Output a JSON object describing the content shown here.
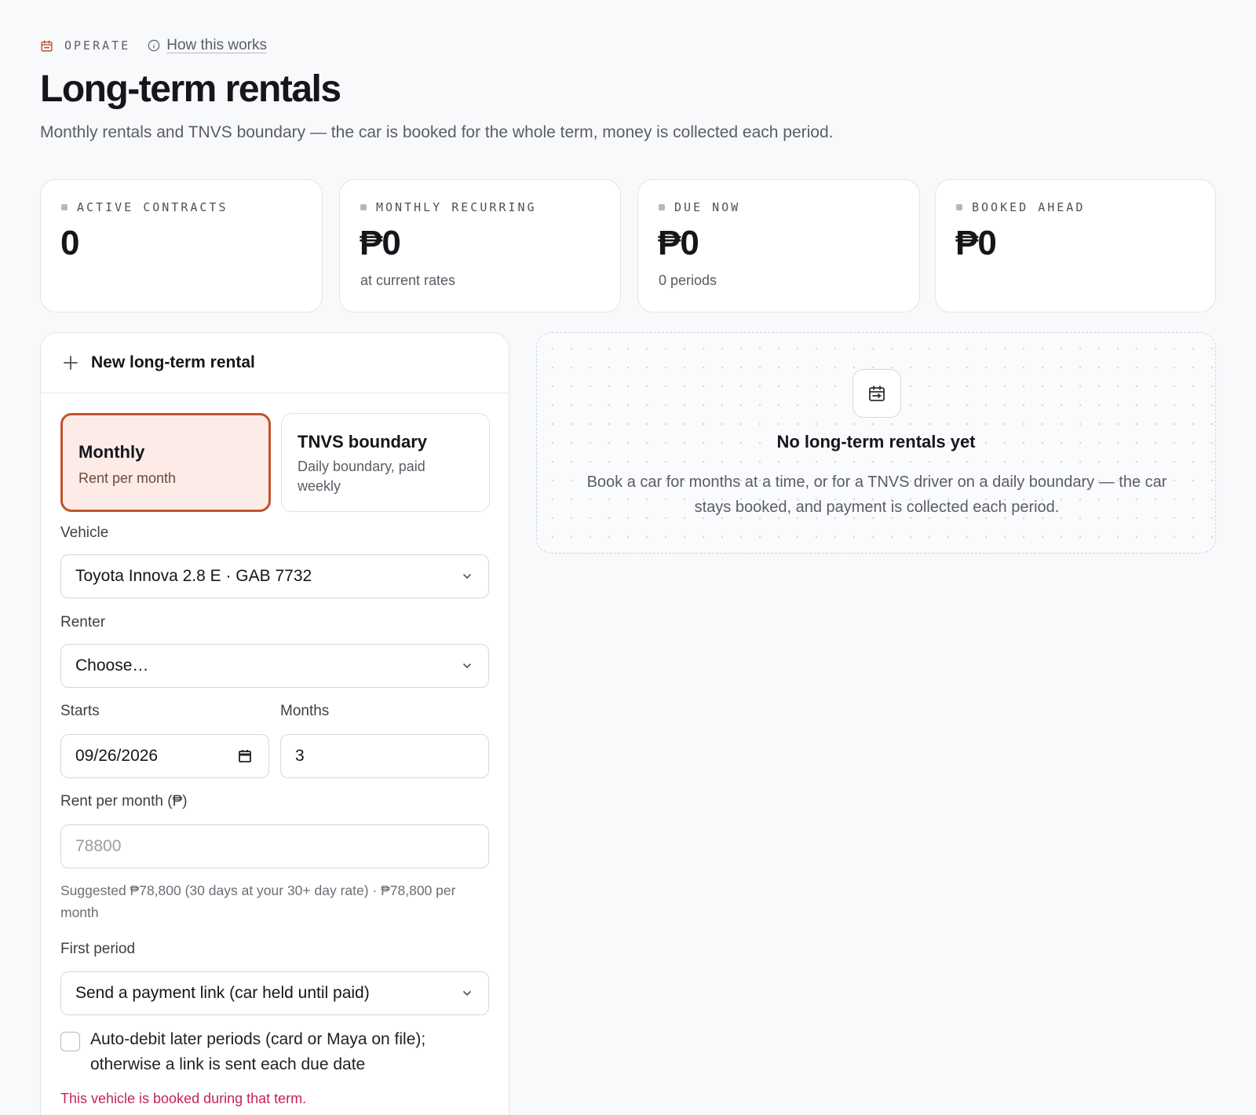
{
  "header": {
    "eyebrow": "OPERATE",
    "help_link": "How this works",
    "title": "Long-term rentals",
    "subtitle": "Monthly rentals and TNVS boundary — the car is booked for the whole term, money is collected each period."
  },
  "stats": [
    {
      "label": "ACTIVE CONTRACTS",
      "value": "0",
      "sub": ""
    },
    {
      "label": "MONTHLY RECURRING",
      "value": "₱0",
      "sub": "at current rates"
    },
    {
      "label": "DUE NOW",
      "value": "₱0",
      "sub": "0 periods"
    },
    {
      "label": "BOOKED AHEAD",
      "value": "₱0",
      "sub": ""
    }
  ],
  "form": {
    "title": "New long-term rental",
    "types": [
      {
        "title": "Monthly",
        "desc": "Rent per month",
        "selected": true
      },
      {
        "title": "TNVS boundary",
        "desc": "Daily boundary, paid weekly",
        "selected": false
      }
    ],
    "vehicle": {
      "label": "Vehicle",
      "value": "Toyota Innova 2.8 E · GAB 7732"
    },
    "renter": {
      "label": "Renter",
      "value": "Choose…"
    },
    "starts": {
      "label": "Starts",
      "value": "09/26/2026"
    },
    "months": {
      "label": "Months",
      "value": "3"
    },
    "rent": {
      "label": "Rent per month (₱)",
      "placeholder": "78800"
    },
    "rent_hint": "Suggested ₱78,800 (30 days at your 30+ day rate) · ₱78,800 per month",
    "first_period": {
      "label": "First period",
      "value": "Send a payment link (car held until paid)"
    },
    "auto_debit": {
      "label": "Auto-debit later periods (card or Maya on file); otherwise a link is sent each due date",
      "checked": false
    },
    "error": "This vehicle is booked during that term."
  },
  "empty_state": {
    "title": "No long-term rentals yet",
    "desc": "Book a car for months at a time, or for a TNVS driver on a daily boundary — the car stays booked, and payment is collected each period."
  },
  "colors": {
    "accent": "#c0532e",
    "accent_bg": "#fcebe6",
    "error": "#c2255c"
  }
}
